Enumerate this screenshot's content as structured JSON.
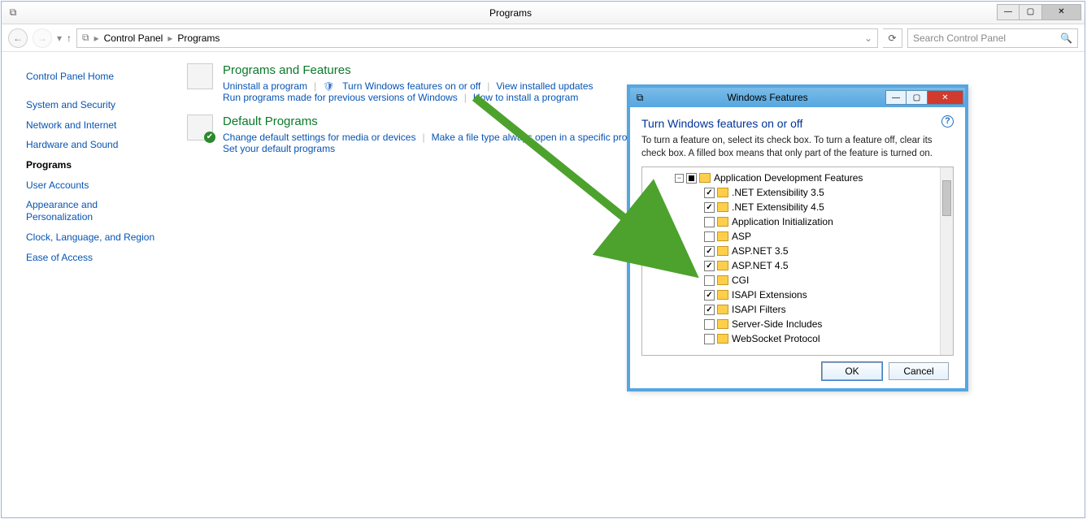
{
  "window": {
    "title": "Programs"
  },
  "nav": {
    "crumb1": "Control Panel",
    "crumb2": "Programs",
    "search_placeholder": "Search Control Panel"
  },
  "sidebar": {
    "items": [
      {
        "label": "Control Panel Home"
      },
      {
        "label": "System and Security"
      },
      {
        "label": "Network and Internet"
      },
      {
        "label": "Hardware and Sound"
      },
      {
        "label": "Programs",
        "current": true
      },
      {
        "label": "User Accounts"
      },
      {
        "label": "Appearance and Personalization"
      },
      {
        "label": "Clock, Language, and Region"
      },
      {
        "label": "Ease of Access"
      }
    ]
  },
  "sections": {
    "pf": {
      "title": "Programs and Features",
      "uninstall": "Uninstall a program",
      "turn_windows": "Turn Windows features on or off",
      "view_updates": "View installed updates",
      "run_compat": "Run programs made for previous versions of Windows",
      "how_install": "How to install a program"
    },
    "dp": {
      "title": "Default Programs",
      "change_defaults": "Change default settings for media or devices",
      "file_assoc": "Make a file type always open in a specific program",
      "set_defaults": "Set your default programs"
    }
  },
  "dialog": {
    "title": "Windows Features",
    "heading": "Turn Windows features on or off",
    "description": "To turn a feature on, select its check box. To turn a feature off, clear its check box. A filled box means that only part of the feature is turned on.",
    "ok": "OK",
    "cancel": "Cancel",
    "tree": {
      "root": {
        "label": "Application Development Features",
        "state": "partial"
      },
      "children": [
        {
          "label": ".NET Extensibility 3.5",
          "state": "checked"
        },
        {
          "label": ".NET Extensibility 4.5",
          "state": "checked"
        },
        {
          "label": "Application Initialization",
          "state": ""
        },
        {
          "label": "ASP",
          "state": ""
        },
        {
          "label": "ASP.NET 3.5",
          "state": "checked"
        },
        {
          "label": "ASP.NET 4.5",
          "state": "checked"
        },
        {
          "label": "CGI",
          "state": ""
        },
        {
          "label": "ISAPI Extensions",
          "state": "checked"
        },
        {
          "label": "ISAPI Filters",
          "state": "checked"
        },
        {
          "label": "Server-Side Includes",
          "state": ""
        },
        {
          "label": "WebSocket Protocol",
          "state": ""
        }
      ]
    }
  }
}
